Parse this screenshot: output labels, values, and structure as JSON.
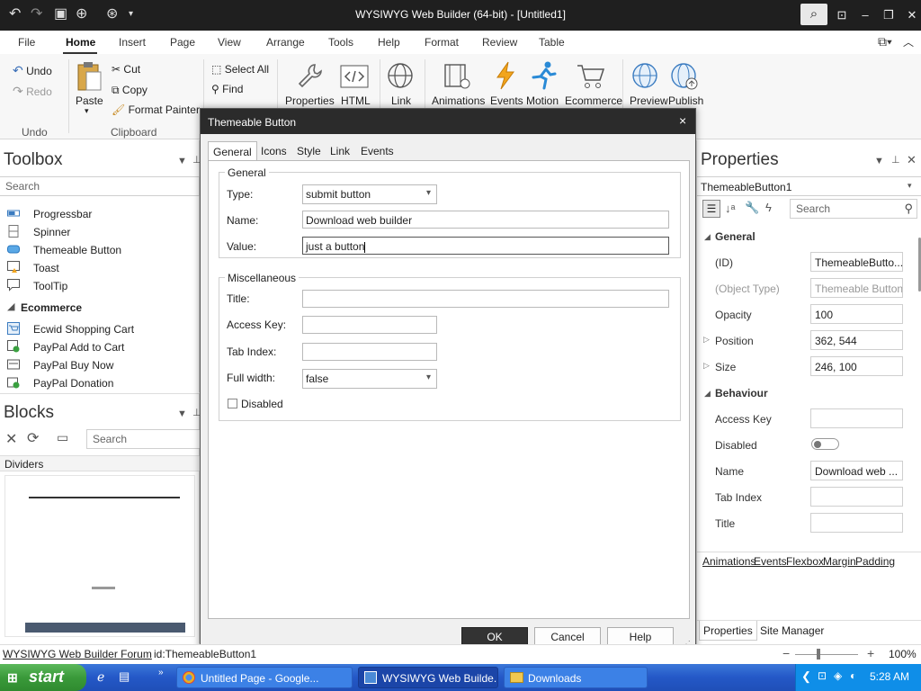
{
  "window": {
    "title": "WYSIWYG Web Builder (64-bit) - [Untitled1]"
  },
  "menu": [
    "File",
    "Home",
    "Insert",
    "Page",
    "View",
    "Arrange",
    "Tools",
    "Help",
    "Format",
    "Review",
    "Table"
  ],
  "ribbon": {
    "undo": "Undo",
    "redo": "Redo",
    "undo_group": "Undo",
    "paste": "Paste",
    "cut": "Cut",
    "copy": "Copy",
    "format_painter": "Format Painter",
    "clipboard_group": "Clipboard",
    "select_all": "Select All",
    "find": "Find",
    "properties": "Properties",
    "html": "HTML",
    "link": "Link",
    "animations": "Animations",
    "events": "Events",
    "motion": "Motion",
    "ecommerce": "Ecommerce",
    "preview": "Preview",
    "publish": "Publish"
  },
  "toolbox": {
    "title": "Toolbox",
    "search_placeholder": "Search",
    "items": [
      "Progressbar",
      "Spinner",
      "Themeable Button",
      "Toast",
      "ToolTip"
    ],
    "category": "Ecommerce",
    "ecommerce_items": [
      "Ecwid Shopping Cart",
      "PayPal Add to Cart",
      "PayPal Buy Now",
      "PayPal Donation"
    ]
  },
  "blocks": {
    "title": "Blocks",
    "search_placeholder": "Search",
    "category": "Dividers"
  },
  "properties": {
    "title": "Properties",
    "object": "ThemeableButton1",
    "search_placeholder": "Search",
    "general": "General",
    "rows": [
      {
        "label": "(ID)",
        "value": "ThemeableButto..."
      },
      {
        "label": "(Object Type)",
        "value": "Themeable Button"
      },
      {
        "label": "Opacity",
        "value": "100"
      },
      {
        "label": "Position",
        "value": "362, 544"
      },
      {
        "label": "Size",
        "value": "246, 100"
      }
    ],
    "behaviour": "Behaviour",
    "brows": [
      {
        "label": "Access Key",
        "value": ""
      },
      {
        "label": "Disabled",
        "value": ""
      },
      {
        "label": "Name",
        "value": "Download web ..."
      },
      {
        "label": "Tab Index",
        "value": ""
      },
      {
        "label": "Title",
        "value": ""
      }
    ],
    "links": [
      "Animations",
      "Events",
      "Flexbox",
      "Margin",
      "Padding"
    ],
    "tabs": [
      "Properties",
      "Site Manager"
    ]
  },
  "dialog": {
    "title": "Themeable Button",
    "close": "×",
    "tabs": [
      "General",
      "Icons",
      "Style",
      "Link",
      "Events"
    ],
    "group_general": "General",
    "type_label": "Type:",
    "type_value": "submit button",
    "name_label": "Name:",
    "name_value": "Download web builder",
    "value_label": "Value:",
    "value_value": "just a button",
    "group_misc": "Miscellaneous",
    "title_label": "Title:",
    "title_value": "",
    "access_label": "Access Key:",
    "access_value": "",
    "tabindex_label": "Tab Index:",
    "tabindex_value": "",
    "fullwidth_label": "Full width:",
    "fullwidth_value": "false",
    "disabled_label": "Disabled",
    "ok": "OK",
    "cancel": "Cancel",
    "help": "Help"
  },
  "status": {
    "forum": "WYSIWYG Web Builder Forum",
    "id": "id:ThemeableButton1",
    "zoom": "100%"
  },
  "taskbar": {
    "start": "start",
    "tasks": [
      "Untitled Page - Google...",
      "WYSIWYG Web Builde...",
      "Downloads"
    ],
    "time": "5:28 AM"
  },
  "colors": {
    "title_bg": "#1f1f1f",
    "dialog_title_bg": "#2b2b2b",
    "ok_bg": "#333333",
    "taskbar": "#2458c7",
    "start": "#3a9a3a"
  }
}
